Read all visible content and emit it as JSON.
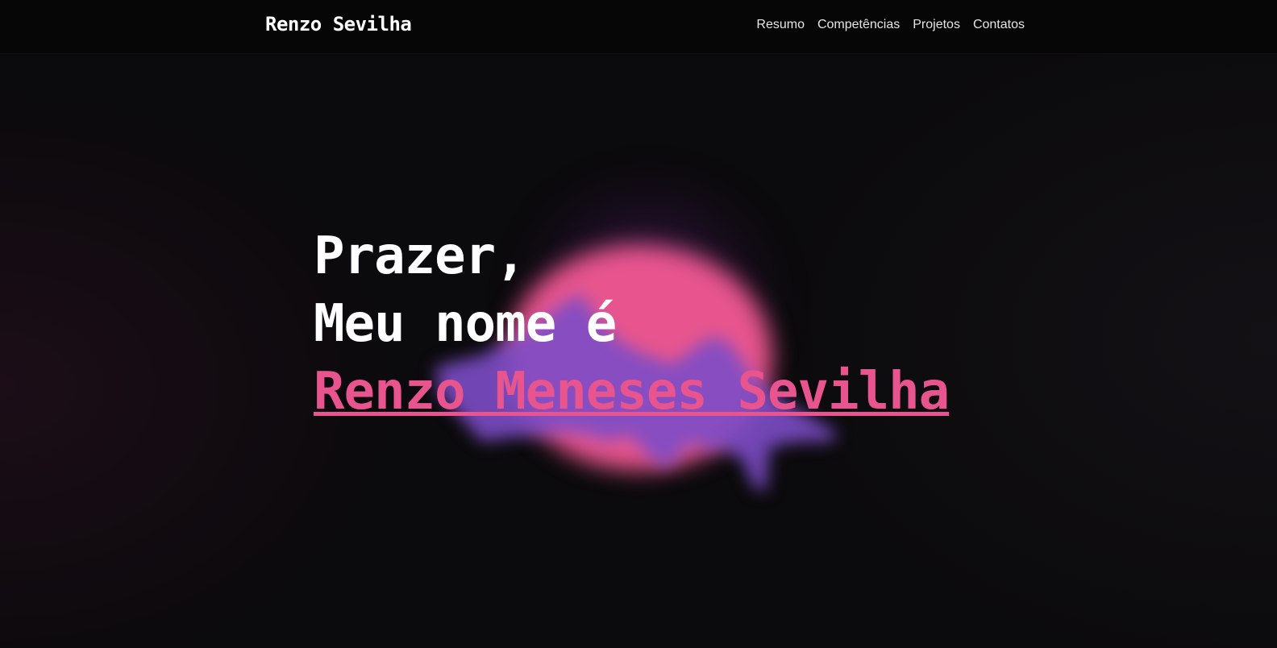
{
  "header": {
    "brand": "Renzo Sevilha",
    "nav": [
      {
        "label": "Resumo"
      },
      {
        "label": "Competências"
      },
      {
        "label": "Projetos"
      },
      {
        "label": "Contatos"
      }
    ]
  },
  "hero": {
    "line1": "Prazer,",
    "line2": "Meu nome é",
    "name": "Renzo Meneses Sevilha"
  },
  "colors": {
    "accent": "#e8558e",
    "background": "#0b0a0c",
    "navbar": "#060606",
    "mountain": "#7c4dc6"
  }
}
